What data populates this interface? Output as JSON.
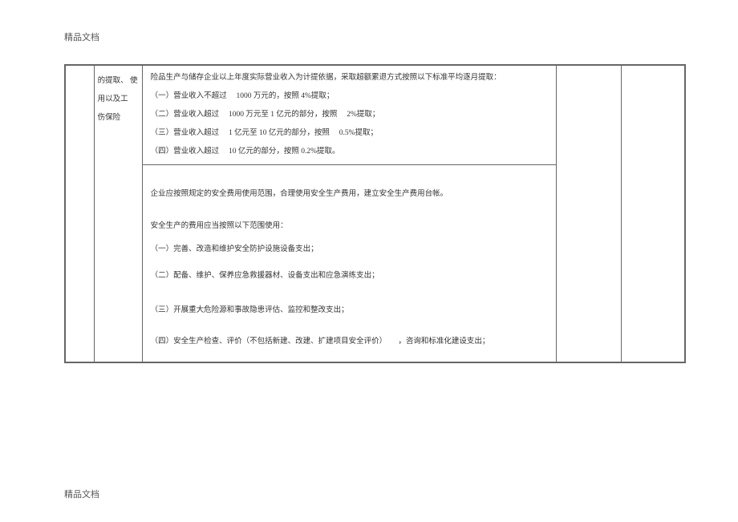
{
  "header": "精品文档",
  "footer": "精品文档",
  "col2_text": [
    "的提取、 使",
    "用以及工",
    "伤保险"
  ],
  "section_upper": {
    "intro": "险品生产与储存企业以上年度实际营业收入为计提依据，采取超额累退方式按照以下标准平均逐月提取：",
    "items": [
      "（一）营业收入不超过　 1000 万元的，按照  4%提取；",
      "（二）营业收入超过　 1000 万元至 1 亿元的部分，按照　 2%提取；",
      "（三）营业收入超过　 1 亿元至 10 亿元的部分，按照　  0.5%提取；",
      "（四）营业收入超过　 10 亿元的部分，按照  0.2%提取。"
    ]
  },
  "section_lower": {
    "p1": "企业应按照规定的安全费用使用范围，合理使用安全生产费用，建立安全生产费用台帐。",
    "p2": "安全生产的费用应当按照以下范围使用：",
    "items": [
      "（一）完善、改造和维护安全防护设施设备支出；",
      "（二）配备、维护、保养应急救援器材、设备支出和应急演练支出；",
      "（三）开展重大危险源和事故隐患评估、监控和整改支出；",
      "（四）安全生产检查、评价（不包括新建、改建、扩建项目安全评价）　　，咨询和标准化建设支出；"
    ]
  }
}
